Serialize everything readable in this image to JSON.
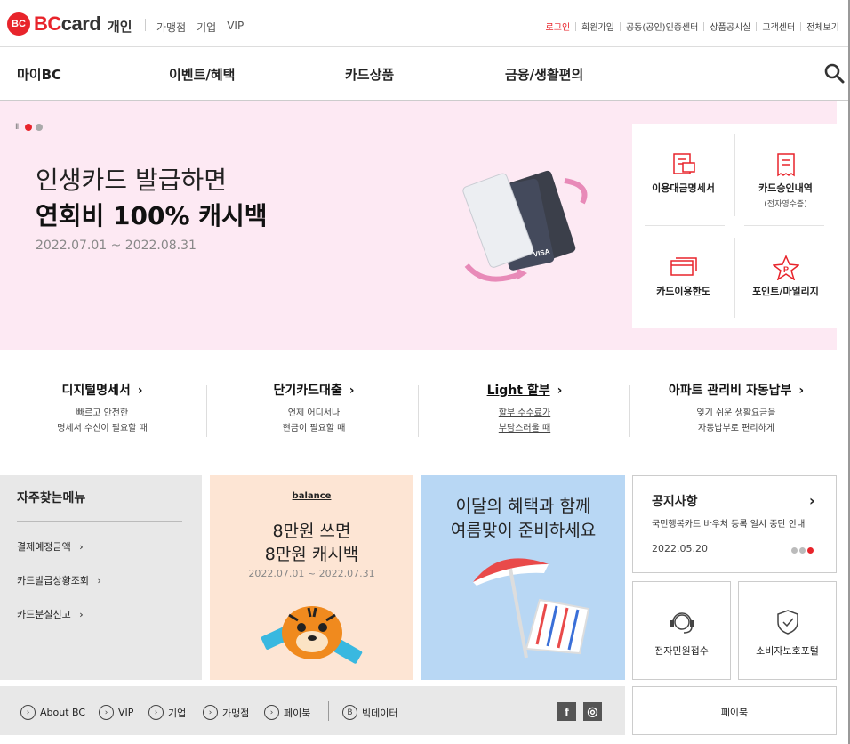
{
  "header": {
    "logo_mark": "BC",
    "logo_word_red": "BC",
    "logo_word_rest": "card",
    "brand_sub": "개인",
    "segments": [
      "가맹점",
      "기업",
      "VIP"
    ],
    "util_links": [
      "로그인",
      "회원가입",
      "공동(공인)인증센터",
      "상품공시실",
      "고객센터",
      "전체보기"
    ]
  },
  "gnb": {
    "items": [
      "마이BC",
      "이벤트/혜택",
      "카드상품",
      "금융/생활편의"
    ],
    "search_icon": "search-icon"
  },
  "hero": {
    "pause_symbol": "II",
    "title1": "인생카드 발급하면",
    "title2": "연회비 100% 캐시백",
    "date": "2022.07.01 ~ 2022.08.31"
  },
  "quick_menu": {
    "items": [
      {
        "label": "이용대금명세서",
        "sub": "",
        "icon": "statement-icon"
      },
      {
        "label": "카드승인내역",
        "sub": "(전자영수증)",
        "icon": "receipt-icon"
      },
      {
        "label": "카드이용한도",
        "sub": "",
        "icon": "card-limit-icon"
      },
      {
        "label": "포인트/마일리지",
        "sub": "",
        "icon": "point-star-icon"
      }
    ]
  },
  "services": [
    {
      "title": "디지털명세서",
      "arrow": "›",
      "desc1": "빠르고 안전한",
      "desc2": "명세서 수신이 필요할 때"
    },
    {
      "title": "단기카드대출",
      "arrow": "›",
      "desc1": "언제 어디서나",
      "desc2": "현금이 필요할 때"
    },
    {
      "title": "Light 할부",
      "arrow": "›",
      "desc1": "할부 수수료가",
      "desc2": "부담스러울 때"
    },
    {
      "title": "아파트 관리비 자동납부",
      "arrow": "›",
      "desc1": "잊기 쉬운 생활요금을",
      "desc2": "자동납부로 편리하게"
    }
  ],
  "faq": {
    "title": "자주찾는메뉴",
    "items": [
      "결제예정금액",
      "카드발급상황조회",
      "카드분실신고"
    ],
    "arrow": "›"
  },
  "promo1": {
    "brand": "balance",
    "title1": "8만원 쓰면",
    "title2": "8만원 캐시백",
    "date": "2022.07.01 ~ 2022.07.31"
  },
  "promo2": {
    "title1": "이달의 혜택과 함께",
    "title2": "여름맞이 준비하세요"
  },
  "notice": {
    "title": "공지사항",
    "arrow": "›",
    "text": "국민행복카드 바우처 등록 일시 중단 안내",
    "date": "2022.05.20"
  },
  "boxes": {
    "complaint": "전자민원접수",
    "consumer": "소비자보호포털"
  },
  "footer": {
    "links": [
      "About BC",
      "VIP",
      "기업",
      "가맹점",
      "페이북"
    ],
    "bigdata": "빅데이터",
    "bigdata_icon_letter": "B",
    "sns": [
      "f",
      "◎"
    ]
  },
  "paybook": "페이북",
  "colors": {
    "accent": "#e8242b",
    "hero_bg": "#fde9f3",
    "faq_bg": "#e8e8e8"
  }
}
